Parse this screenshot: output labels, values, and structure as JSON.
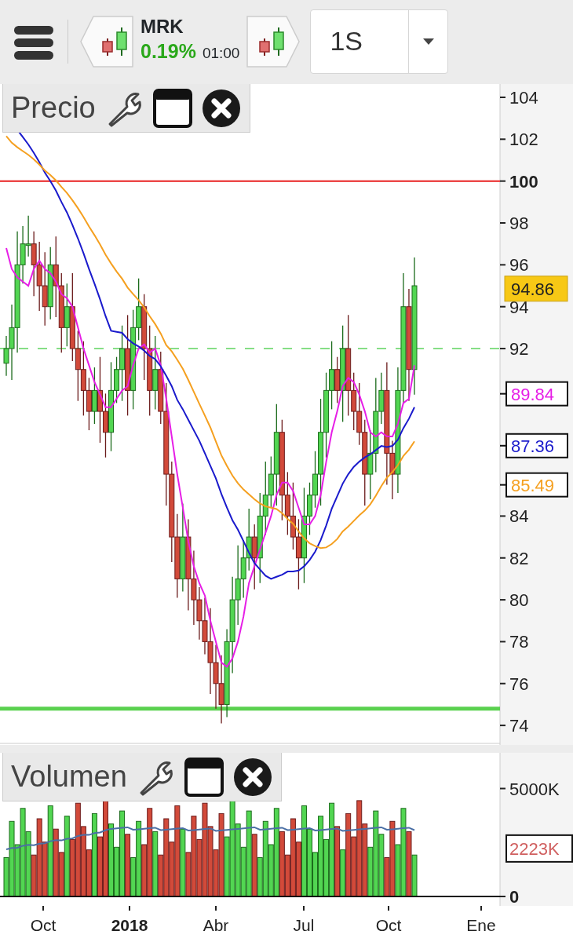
{
  "toolbar": {
    "symbol": "MRK",
    "change": "0.19%",
    "time": "01:00",
    "timeframe": "1S"
  },
  "price_panel": {
    "title": "Precio",
    "y_ticks": [
      {
        "label": "104",
        "bold": false
      },
      {
        "label": "102",
        "bold": false
      },
      {
        "label": "100",
        "bold": true
      },
      {
        "label": "98",
        "bold": false
      },
      {
        "label": "96",
        "bold": false
      },
      {
        "label": "94",
        "bold": false
      },
      {
        "label": "92",
        "bold": false
      },
      {
        "label": "84",
        "bold": false
      },
      {
        "label": "82",
        "bold": false
      },
      {
        "label": "80",
        "bold": false
      },
      {
        "label": "78",
        "bold": false
      },
      {
        "label": "76",
        "bold": false
      },
      {
        "label": "74",
        "bold": false
      }
    ],
    "last_price": "94.86",
    "ma_labels": [
      {
        "text": "89.84",
        "color": "#e61ee6"
      },
      {
        "text": "87.36",
        "color": "#1a1acc"
      },
      {
        "text": "85.49",
        "color": "#f5a020"
      }
    ]
  },
  "volume_panel": {
    "title": "Volumen",
    "y_ticks": [
      {
        "label": "5000K",
        "bold": false
      },
      {
        "label": "0",
        "bold": true
      }
    ],
    "last_volume": "2223K"
  },
  "x_axis": [
    {
      "label": "Oct",
      "bold": false
    },
    {
      "label": "2018",
      "bold": true
    },
    {
      "label": "Abr",
      "bold": false
    },
    {
      "label": "Jul",
      "bold": false
    },
    {
      "label": "Oct",
      "bold": false
    },
    {
      "label": "Ene",
      "bold": false
    }
  ]
}
